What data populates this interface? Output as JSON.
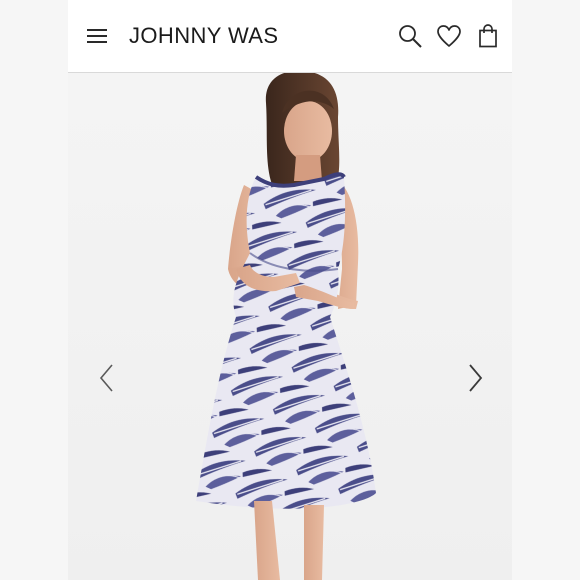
{
  "header": {
    "brand": "JOHNNY WAS",
    "icons": {
      "menu": "hamburger-menu-icon",
      "search": "search-icon",
      "wishlist": "heart-icon",
      "cart": "shopping-bag-icon"
    }
  },
  "gallery": {
    "image": "model-wearing-printed-midi-dress",
    "prev_icon": "chevron-left-icon",
    "next_icon": "chevron-right-icon"
  },
  "colors": {
    "background": "#ffffff",
    "text": "#1b1b1b",
    "divider": "#d9d9d9",
    "dress_primary": "#4a4d8a",
    "dress_light": "#e9e8f2"
  }
}
